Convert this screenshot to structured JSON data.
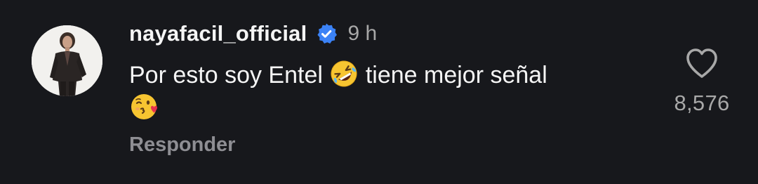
{
  "comment": {
    "username": "nayafacil_official",
    "verified": true,
    "time": "9 h",
    "text_part1": "Por esto soy Entel",
    "text_part2": "tiene mejor señal",
    "emoji_1": "rolling-on-floor-laughing-emoji",
    "emoji_2": "face-blowing-kiss-emoji",
    "reply_label": "Responder",
    "like_count": "8,576",
    "like_icon": "heart-outline-icon"
  },
  "colors": {
    "background": "#17181c",
    "text_primary": "#f5f5f5",
    "text_secondary": "#a8a8a8",
    "verified_blue": "#3b82f6"
  }
}
